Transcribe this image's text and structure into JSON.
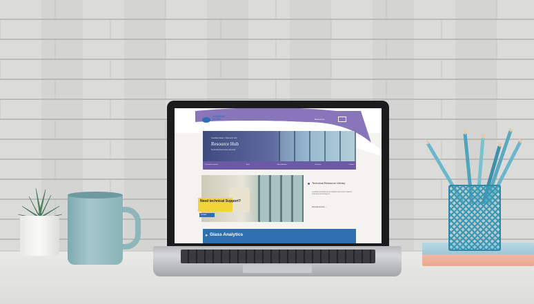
{
  "screen_page": {
    "logo_text_line1": "GUARDIAN",
    "logo_text_line2": "GLASS",
    "nav_label": "Resources",
    "hero": {
      "breadcrumb": "Guardian Glass > Resource Hub",
      "title": "Resource Hub",
      "subtitle": "Technical documents and tools"
    },
    "strip_items": [
      "Technical resources",
      "Tools",
      "Glass Analytics",
      "Literature",
      "Contact"
    ],
    "promo_badge": "Need technical Support?",
    "promo_button": "Contact",
    "card": {
      "title": "Technical Resource Library",
      "body": "Guardian technical documentation and product data for architects and designers.",
      "link": "View Resources →"
    },
    "glass_analytics_label": "Glass Analytics",
    "chevron_glyph": "▸"
  },
  "colors": {
    "brand_blue": "#2f71b0",
    "brand_purple": "#6d5aa6",
    "badge_yellow": "#f1d33a",
    "mug_teal": "#a3c7cc"
  },
  "icons": [
    "logo-mark-icon",
    "chevron-right-icon",
    "bullet-icon"
  ]
}
